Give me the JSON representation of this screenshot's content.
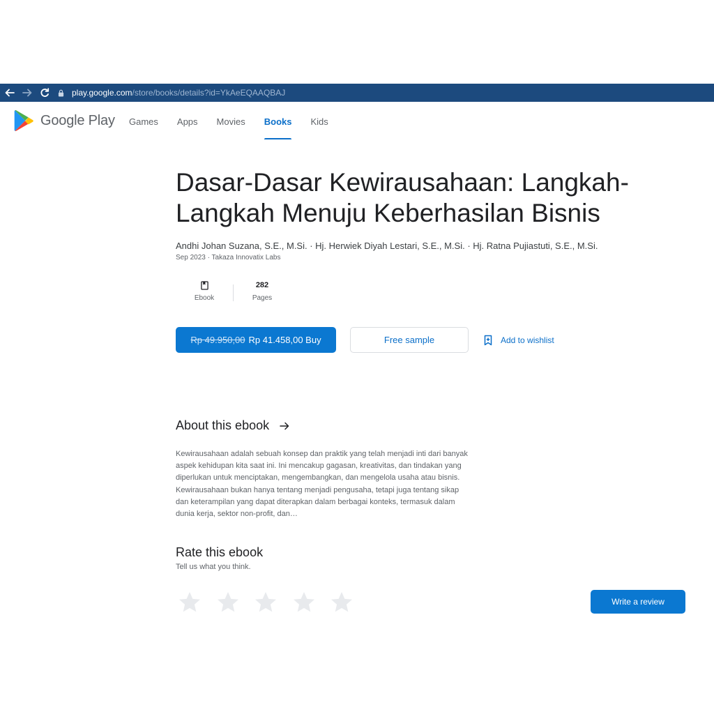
{
  "browser": {
    "url_host": "play.google.com",
    "url_path": "/store/books/details?id=YkAeEQAAQBAJ"
  },
  "header": {
    "logo_text": "Google Play",
    "tabs": [
      {
        "label": "Games",
        "active": false
      },
      {
        "label": "Apps",
        "active": false
      },
      {
        "label": "Movies",
        "active": false
      },
      {
        "label": "Books",
        "active": true
      },
      {
        "label": "Kids",
        "active": false
      }
    ]
  },
  "book": {
    "title": "Dasar-Dasar Kewirausahaan: Langkah-Langkah Menuju Keberhasilan Bisnis",
    "authors": "Andhi Johan Suzana, S.E., M.Si. · Hj. Herwiek Diyah Lestari, S.E., M.Si. · Hj. Ratna Pujiastuti, S.E., M.Si.",
    "meta": "Sep 2023 · Takaza Innovatix Labs",
    "stats": [
      {
        "icon": "ebook-icon",
        "label": "Ebook"
      },
      {
        "value": "282",
        "label": "Pages"
      }
    ]
  },
  "actions": {
    "old_price": "Rp 49.950,00",
    "buy_label": "Rp 41.458,00 Buy",
    "sample_label": "Free sample",
    "wishlist_label": "Add to wishlist"
  },
  "about": {
    "title": "About this ebook",
    "description": "Kewirausahaan adalah sebuah konsep dan praktik yang telah menjadi inti dari banyak aspek kehidupan kita saat ini. Ini mencakup gagasan, kreativitas, dan tindakan yang diperlukan untuk menciptakan, mengembangkan, dan mengelola usaha atau bisnis. Kewirausahaan bukan hanya tentang menjadi pengusaha, tetapi juga tentang sikap dan keterampilan yang dapat diterapkan dalam berbagai konteks, termasuk dalam dunia kerja, sektor non-profit, dan…"
  },
  "rate": {
    "title": "Rate this ebook",
    "subtitle": "Tell us what you think.",
    "star_count": 5,
    "write_review_label": "Write a review"
  },
  "colors": {
    "browser_bar": "#1c4a7e",
    "accent": "#0b6fc9",
    "button_fill": "#0b78d1",
    "star_empty": "#e8eaed"
  }
}
